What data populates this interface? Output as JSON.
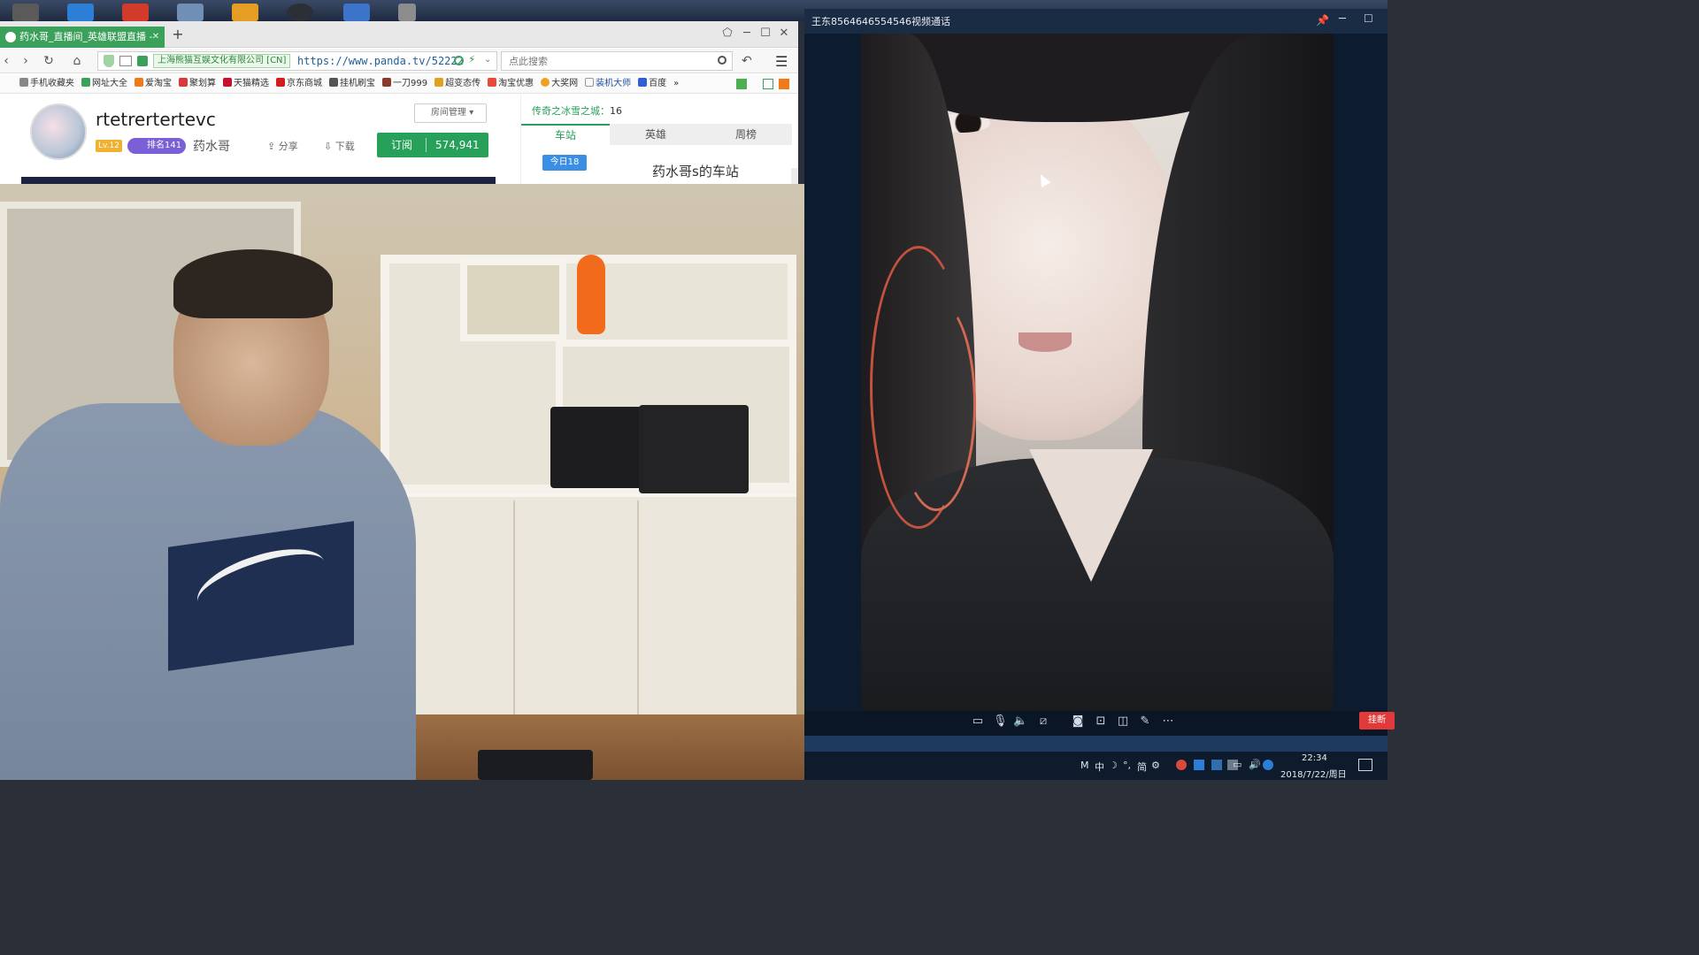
{
  "desktop": {
    "icons": [
      "app-icon",
      "app-icon",
      "app-icon",
      "app-icon",
      "app-icon",
      "app-icon",
      "app-icon",
      "app-icon"
    ]
  },
  "browser": {
    "tab_title": "药水哥_直播间_英雄联盟直播 -",
    "new_tab": "+",
    "cert_label": "上海熊猫互娱文化有限公司 [CN]",
    "url": "https://www.panda.tv/52222",
    "search_placeholder": "点此搜索",
    "window_controls": {
      "minimize": "─",
      "maximize": "☐",
      "close": "✕"
    },
    "bookmarks": [
      "手机收藏夹",
      "网址大全",
      "爱淘宝",
      "聚划算",
      "天猫精选",
      "京东商城",
      "挂机刷宝",
      "一刀999",
      "超变态传",
      "淘宝优惠",
      "大奖网",
      "装机大师",
      "百度"
    ],
    "bookmarks_more": "»"
  },
  "room": {
    "title": "rtetrertertevc",
    "manage_label": "房间管理",
    "level": "Lv.12",
    "rank": "排名141",
    "host": "药水哥",
    "share": "分享",
    "download": "下载",
    "subscribe_label": "订阅",
    "subscribe_count": "574,941"
  },
  "side_panel": {
    "game_label": "传奇之冰雪之城",
    "game_separator": "：",
    "game_value": "16",
    "tabs": [
      "车站",
      "英雄",
      "周榜"
    ],
    "active_tab": "车站",
    "today_badge": "今日18",
    "station_title": "药水哥s的车站"
  },
  "call": {
    "title": "王东8564646554546视频通话",
    "hangup_label": "挂断",
    "toolbar_icons": [
      "chat-icon",
      "microphone-icon",
      "speaker-icon",
      "camera-off-icon",
      "screenshot-icon",
      "recording-icon",
      "layout-icon",
      "edit-icon",
      "more-icon"
    ]
  },
  "taskbar": {
    "tray_items": [
      "M",
      "中",
      "☽",
      "°,",
      "简",
      "⚙"
    ],
    "time": "22:34",
    "date": "2018/7/22/周日"
  },
  "colors": {
    "accent_green": "#27a05a",
    "call_titlebar": "#1a2c44",
    "hangup_red": "#e03a3a"
  }
}
